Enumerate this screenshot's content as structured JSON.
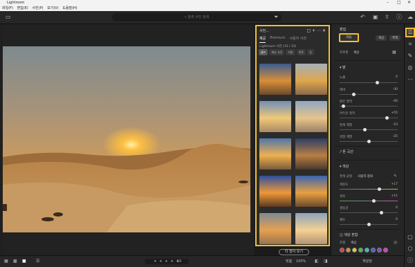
{
  "window": {
    "title": "Lightroom",
    "controls": [
      "–",
      "□",
      "✕"
    ]
  },
  "menu": [
    "파일(F)",
    "편집(E)",
    "사진(P)",
    "보기(V)",
    "도움말(H)"
  ],
  "search": {
    "placeholder": "검색 사진 검색"
  },
  "presets_panel": {
    "title": "사전...",
    "tabs": [
      "제공",
      "Premium",
      "사용자 사전"
    ],
    "subtitle": "Lightroom 사전 (33 / 33)",
    "chips": [
      "골드",
      "재난 사진",
      "자동",
      "따뜻",
      "잊"
    ],
    "more_button": "더 많이 보기"
  },
  "edit_panel": {
    "title": "편집",
    "auto_label": "자동",
    "color_label": "색상",
    "bw_label": "흑백",
    "profile_label": "프로필",
    "profile_value": "색상",
    "light_section": "밝",
    "light_rows": [
      {
        "label": "노출",
        "value": "0"
      },
      {
        "label": "대비",
        "value": "-30"
      },
      {
        "label": "밝은 영역",
        "value": "-40"
      },
      {
        "label": "어두운 영역",
        "value": "+55"
      },
      {
        "label": "흰색 계열",
        "value": "-10"
      },
      {
        "label": "검정 계열",
        "value": "-25"
      }
    ],
    "curve_label": "톤 곡선",
    "color_section": "색상",
    "wb_label": "흰색 균형",
    "wb_value": "사용자 정의",
    "color_rows": [
      {
        "label": "색온도",
        "value": "+17"
      },
      {
        "label": "색조",
        "value": "+11"
      },
      {
        "label": "생동감",
        "value": "0"
      },
      {
        "label": "채도",
        "value": "0"
      }
    ],
    "mix_section": "색상 혼합",
    "mix_sub": "조정",
    "mix_value": "색상",
    "swatch_colors": [
      "#e04040",
      "#e08a30",
      "#e0d030",
      "#40c040",
      "#30c0c0",
      "#4060e0",
      "#9040d0",
      "#d040b0"
    ]
  },
  "bottom": {
    "zoom": "맞춤",
    "zoom_pct": "100%",
    "dots": "★ ★ ★ ★ ★",
    "reset_label": "재설정",
    "edit_badge": "10"
  }
}
